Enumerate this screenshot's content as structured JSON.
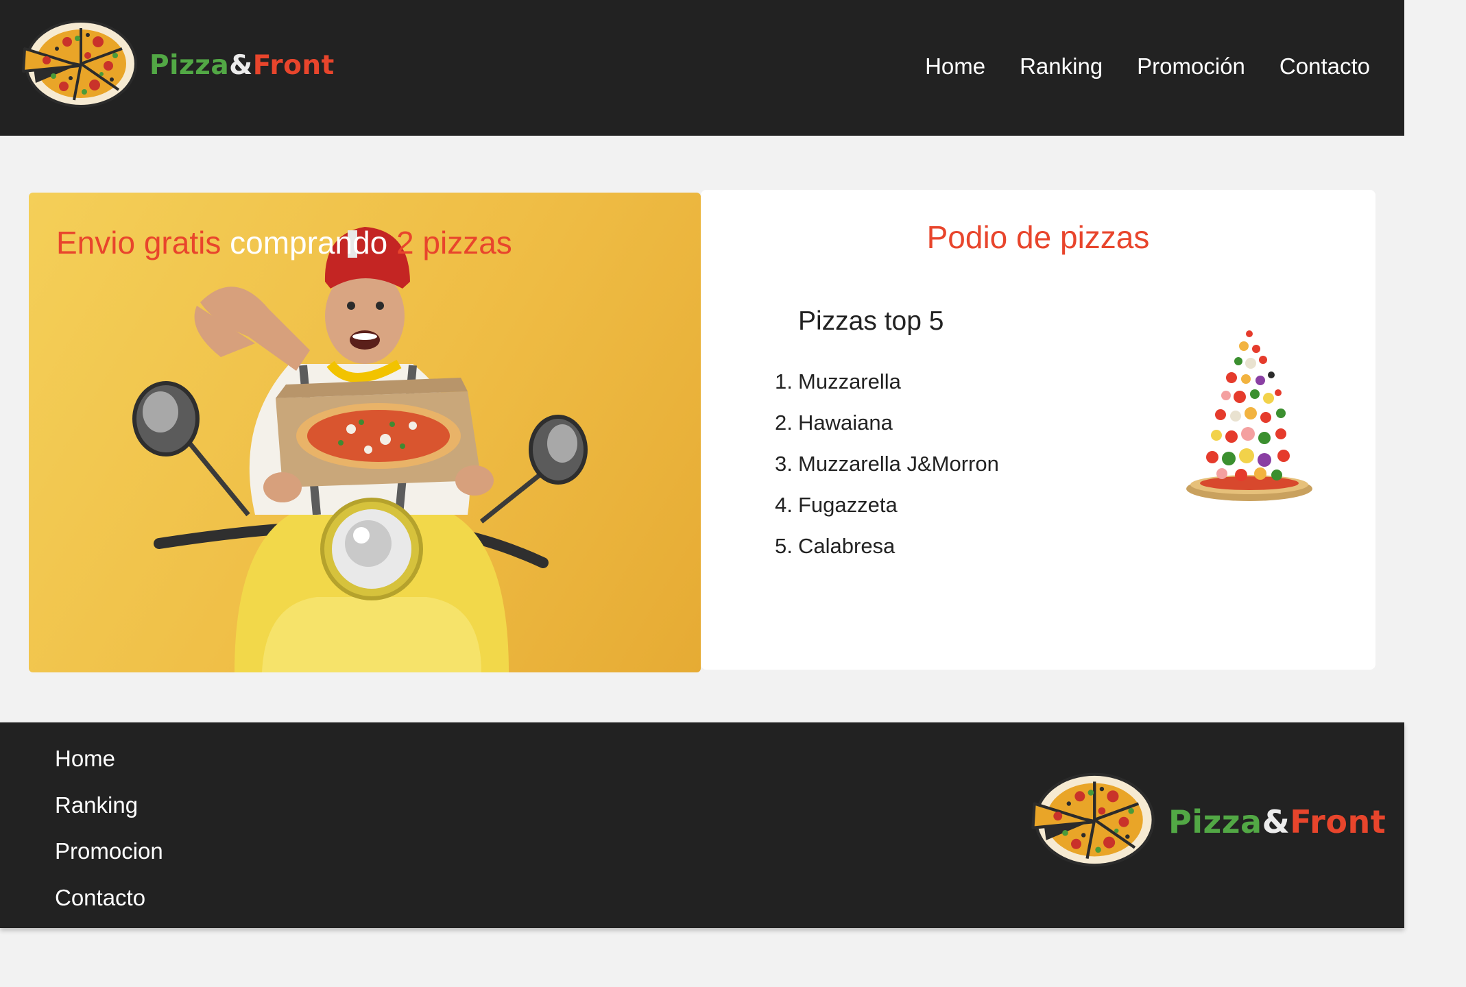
{
  "header": {
    "logo": {
      "word1": "Pizza",
      "amp": "&",
      "word2": "Front"
    },
    "nav": [
      "Home",
      "Ranking",
      "Promoción",
      "Contacto"
    ]
  },
  "promo": {
    "title_part1": "Envio gratis",
    "title_part2": "comprando",
    "title_part3": "2 pizzas"
  },
  "podium": {
    "title": "Podio de pizzas",
    "subtitle": "Pizzas top 5",
    "items": [
      {
        "num": "1.",
        "name": "Muzzarella"
      },
      {
        "num": "2.",
        "name": "Hawaiana"
      },
      {
        "num": "3.",
        "name": "Muzzarella J&Morron"
      },
      {
        "num": "4.",
        "name": "Fugazzeta"
      },
      {
        "num": "5.",
        "name": "Calabresa"
      }
    ]
  },
  "footer": {
    "nav": [
      "Home",
      "Ranking",
      "Promocion",
      "Contacto"
    ],
    "logo": {
      "word1": "Pizza",
      "amp": "&",
      "word2": "Front"
    }
  },
  "colors": {
    "dark_bar": "#222222",
    "page_bg": "#f2f2f2",
    "accent_red": "#e8452c",
    "logo_green": "#52a845",
    "promo_yellow": "#f0c44d"
  },
  "icons": {
    "logo": "pizza-logo-icon",
    "promo_image": "delivery-scooter-image",
    "podium_image": "pizza-ingredients-tower-image"
  }
}
